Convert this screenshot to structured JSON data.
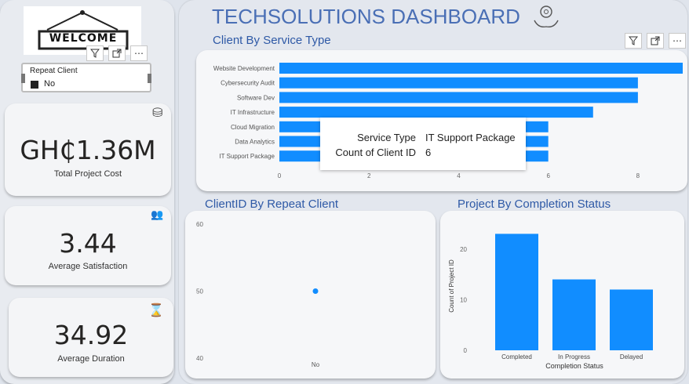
{
  "header": {
    "title": "TECHSOLUTIONS DASHBOARD"
  },
  "logo": {
    "text": "WELCOME"
  },
  "slicer": {
    "label": "Repeat Client",
    "option": "No"
  },
  "kpis": {
    "cost": {
      "value": "GH₵1.36M",
      "label": "Total Project Cost"
    },
    "satisfaction": {
      "value": "3.44",
      "label": "Average Satisfaction"
    },
    "duration": {
      "value": "34.92",
      "label": "Average Duration"
    }
  },
  "toolbar": {
    "filter_icon": "filter-icon",
    "focus_icon": "focus-mode-icon",
    "more_icon": "more-options-icon"
  },
  "tooltip": {
    "k1": "Service Type",
    "v1": "IT Support Package",
    "k2": "Count of Client ID",
    "v2": "6"
  },
  "colors": {
    "accent": "#118dff",
    "title": "#2e59a6"
  },
  "chart_data": [
    {
      "type": "bar",
      "orientation": "horizontal",
      "title": "Client By Service Type",
      "categories": [
        "Website Development",
        "Cybersecurity Audit",
        "Software Dev",
        "IT Infrastructure",
        "Cloud Migration",
        "Data Analytics",
        "IT Support Package"
      ],
      "values": [
        9,
        8,
        8,
        7,
        6,
        6,
        6
      ],
      "xlim": [
        0,
        9
      ],
      "xticks": [
        0,
        2,
        4,
        6,
        8
      ]
    },
    {
      "type": "scatter",
      "title": "ClientID By Repeat Client",
      "categories": [
        "No"
      ],
      "values": [
        50
      ],
      "ylim": [
        40,
        60
      ],
      "yticks": [
        40,
        50,
        60
      ]
    },
    {
      "type": "bar",
      "title": "Project By Completion Status",
      "categories": [
        "Completed",
        "In Progress",
        "Delayed"
      ],
      "values": [
        23,
        14,
        12
      ],
      "xlabel": "Completion Status",
      "ylabel": "Count of Project ID",
      "ylim": [
        0,
        26
      ],
      "yticks": [
        0,
        10,
        20
      ]
    }
  ]
}
